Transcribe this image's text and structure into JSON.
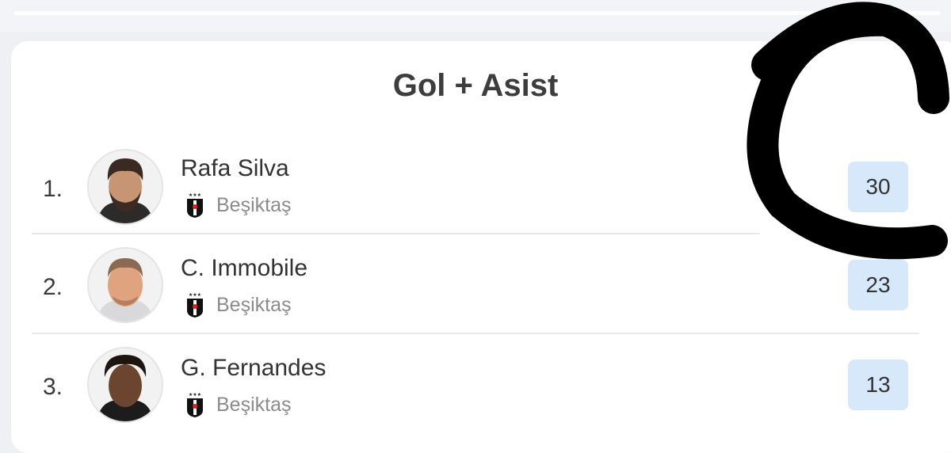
{
  "leaderboard": {
    "title": "Gol + Asist",
    "rows": [
      {
        "rank": "1.",
        "name": "Rafa Silva",
        "team": "Beşiktaş",
        "value": "30"
      },
      {
        "rank": "2.",
        "name": "C. Immobile",
        "team": "Beşiktaş",
        "value": "23"
      },
      {
        "rank": "3.",
        "name": "G. Fernandes",
        "team": "Beşiktaş",
        "value": "13"
      }
    ]
  },
  "colors": {
    "value_background": "#d8e8fb",
    "card_background": "#ffffff",
    "page_background": "#eef0f4",
    "annotation": "#000000"
  },
  "icons": {
    "team_badge": "besiktas-crest-icon",
    "avatar": "player-photo"
  }
}
